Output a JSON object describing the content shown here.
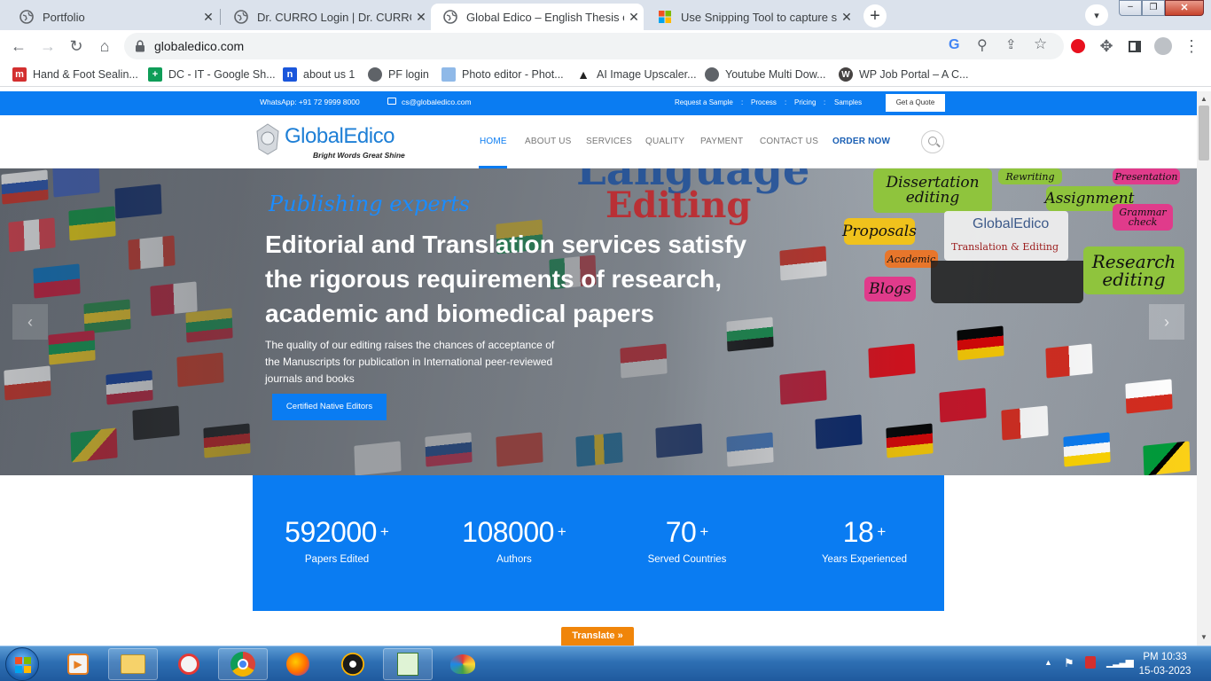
{
  "browser": {
    "tabs": [
      {
        "title": "Portfolio",
        "active": false
      },
      {
        "title": "Dr. CURRO Login | Dr. CURRO | Le",
        "active": false
      },
      {
        "title": "Global Edico – English Thesis editi",
        "active": true
      },
      {
        "title": "Use Snipping Tool to capture scre",
        "active": false
      }
    ],
    "url": "globaledico.com",
    "bookmarks": [
      {
        "label": "Hand & Foot Sealin..."
      },
      {
        "label": "DC - IT - Google Sh..."
      },
      {
        "label": "about us 1"
      },
      {
        "label": "PF login"
      },
      {
        "label": "Photo editor - Phot..."
      },
      {
        "label": "AI Image Upscaler..."
      },
      {
        "label": "Youtube Multi Dow..."
      },
      {
        "label": "WP Job Portal – A C..."
      }
    ]
  },
  "site": {
    "topbar": {
      "whatsapp": "WhatsApp: +91 72 9999 8000",
      "email": "cs@globaledico.com",
      "links": [
        "Request a Sample",
        "Process",
        "Pricing",
        "Samples"
      ],
      "separator": ":",
      "quote_button": "Get a Quote"
    },
    "logo": {
      "name": "GlobalEdico",
      "tagline": "Bright Words Great Shine"
    },
    "nav": [
      "HOME",
      "ABOUT US",
      "SERVICES",
      "QUALITY",
      "PAYMENT",
      "CONTACT US",
      "ORDER NOW"
    ],
    "hero": {
      "kicker": "Publishing experts",
      "headline_lines": [
        "Editorial and Translation services satisfy",
        "the rigorous requirements of research,",
        "academic and biomedical papers"
      ],
      "body_lines": [
        "The quality of our editing raises the chances of acceptance of",
        "the Manuscripts for publication in International peer-reviewed",
        "journals and books"
      ],
      "cta": "Certified Native Editors",
      "image_text": {
        "language": "Language",
        "editing": "Editing",
        "dissertation": "Dissertation editing",
        "rewriting": "Rewriting",
        "presentation": "Presentation",
        "assignment": "Assignment",
        "grammar": "Grammar check",
        "proposals": "Proposals",
        "academic": "Academic",
        "blogs": "Blogs",
        "research": "Research editing",
        "brand": "GlobalEdico",
        "brand_sub": "Translation & Editing"
      }
    },
    "stats": [
      {
        "value": "592000",
        "suffix": "+",
        "label": "Papers Edited"
      },
      {
        "value": "108000",
        "suffix": "+",
        "label": "Authors"
      },
      {
        "value": "70",
        "suffix": "+",
        "label": "Served Countries"
      },
      {
        "value": "18",
        "suffix": "+",
        "label": "Years Experienced"
      }
    ],
    "translate_button": "Translate »"
  },
  "taskbar": {
    "time": "PM 10:33",
    "date": "15-03-2023"
  },
  "colors": {
    "brand_blue": "#0a7cf2",
    "order_now": "#1a5fb4"
  }
}
